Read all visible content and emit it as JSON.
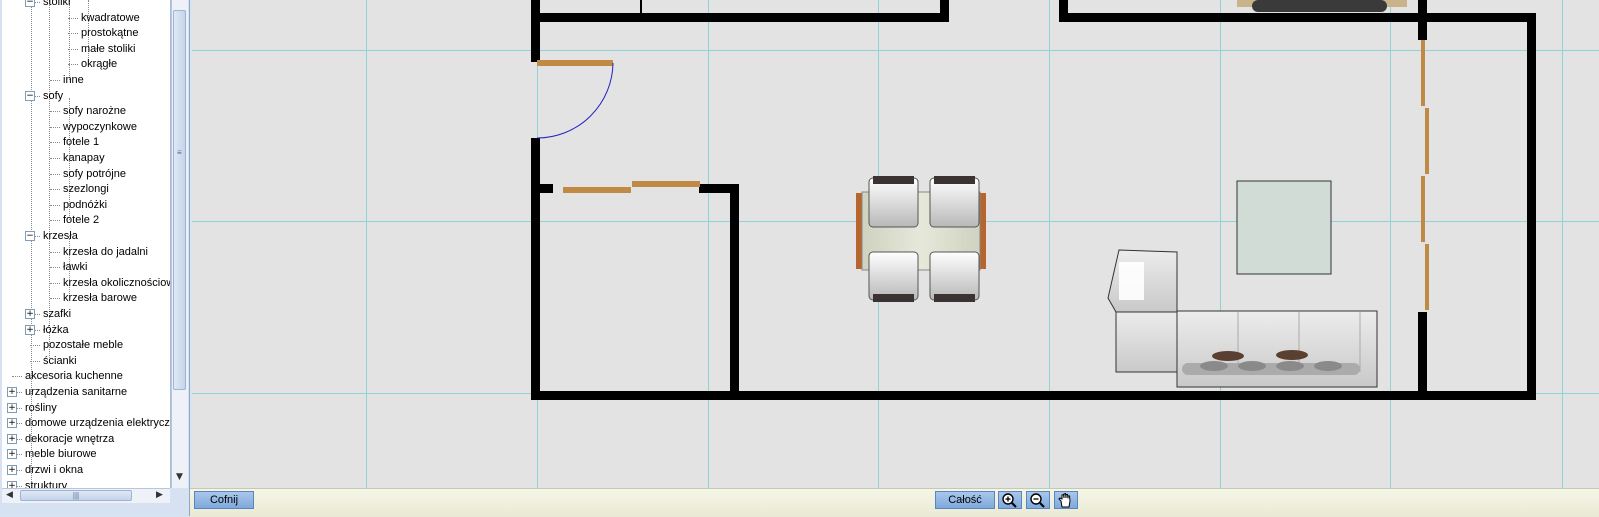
{
  "tree": [
    {
      "label": "stoliki",
      "level": 2,
      "expander": "minus"
    },
    {
      "label": "kwadratowe",
      "level": 4
    },
    {
      "label": "prostokątne",
      "level": 4
    },
    {
      "label": "małe stoliki",
      "level": 4
    },
    {
      "label": "okrągłe",
      "level": 4
    },
    {
      "label": "inne",
      "level": 3
    },
    {
      "label": "sofy",
      "level": 2,
      "expander": "minus"
    },
    {
      "label": "sofy narożne",
      "level": 3
    },
    {
      "label": "wypoczynkowe",
      "level": 3
    },
    {
      "label": "fotele 1",
      "level": 3
    },
    {
      "label": "kanapay",
      "level": 3
    },
    {
      "label": "sofy potrójne",
      "level": 3
    },
    {
      "label": "szezlongi",
      "level": 3
    },
    {
      "label": "podnóżki",
      "level": 3
    },
    {
      "label": "fotele 2",
      "level": 3
    },
    {
      "label": "krzesła",
      "level": 2,
      "expander": "minus"
    },
    {
      "label": "krzesła do jadalni",
      "level": 3
    },
    {
      "label": "ławki",
      "level": 3
    },
    {
      "label": "krzesła okolicznościowe",
      "level": 3
    },
    {
      "label": "krzesła barowe",
      "level": 3
    },
    {
      "label": "szafki",
      "level": 2,
      "expander": "plus"
    },
    {
      "label": "łóżka",
      "level": 2,
      "expander": "plus"
    },
    {
      "label": "pozostałe meble",
      "level": 2
    },
    {
      "label": "ścianki",
      "level": 2
    },
    {
      "label": "akcesoria kuchenne",
      "level": 1
    },
    {
      "label": "urządzenia sanitarne",
      "level": 1,
      "expander": "plus"
    },
    {
      "label": "rośliny",
      "level": 1,
      "expander": "plus"
    },
    {
      "label": "domowe urządzenia elektryczne",
      "level": 1,
      "expander": "plus"
    },
    {
      "label": "dekoracje wnętrza",
      "level": 1,
      "expander": "plus"
    },
    {
      "label": "meble biurowe",
      "level": 1,
      "expander": "plus"
    },
    {
      "label": "drzwi i okna",
      "level": 1,
      "expander": "plus"
    },
    {
      "label": "struktury",
      "level": 1,
      "expander": "plus"
    }
  ],
  "toolbar": {
    "undo_label": "Cofnij",
    "fit_label": "Całość",
    "zoom_in_icon": "zoom-in-icon",
    "zoom_out_icon": "zoom-out-icon",
    "pan_icon": "hand-icon"
  },
  "colors": {
    "canvas_bg": "#e3e3e3",
    "grid": "#8fd3d8",
    "wall": "#000000",
    "door_panel": "#c08a45",
    "door_swing": "#2020c0",
    "table_top": "#d6dbcc",
    "sofa": "#dcdcdc"
  }
}
